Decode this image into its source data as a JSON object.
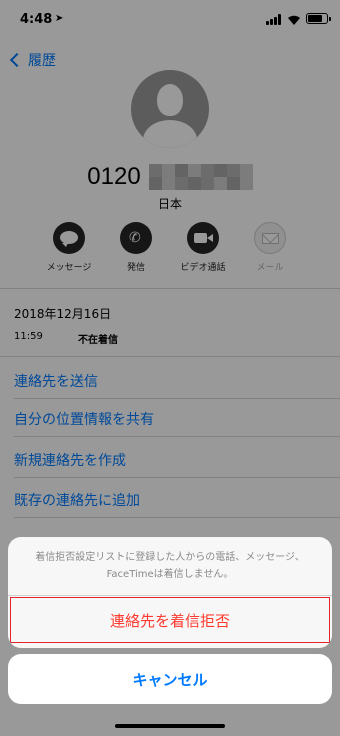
{
  "status_bar": {
    "time": "4:48"
  },
  "nav": {
    "back_label": "履歴"
  },
  "contact": {
    "phone_prefix": "0120",
    "country": "日本"
  },
  "actions": [
    {
      "label": "メッセージ",
      "icon": "message-icon",
      "enabled": true
    },
    {
      "label": "発信",
      "icon": "phone-icon",
      "enabled": true
    },
    {
      "label": "ビデオ通話",
      "icon": "video-icon",
      "enabled": true
    },
    {
      "label": "メール",
      "icon": "mail-icon",
      "enabled": false
    }
  ],
  "call_log": {
    "date": "2018年12月16日",
    "time": "11:59",
    "status": "不在着信"
  },
  "menu": [
    "連絡先を送信",
    "自分の位置情報を共有",
    "新規連絡先を作成",
    "既存の連絡先に追加"
  ],
  "action_sheet": {
    "message": "着信拒否設定リストに登録した人からの電話、メッセージ、FaceTimeは着信しません。",
    "block_label": "連絡先を着信拒否",
    "cancel_label": "キャンセル"
  },
  "colors": {
    "accent": "#007aff",
    "destructive": "#ff3b30",
    "highlight_border": "#e0262c"
  }
}
